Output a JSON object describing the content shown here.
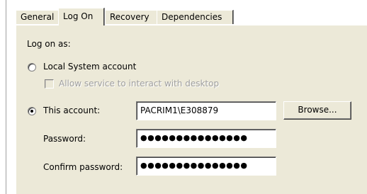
{
  "tabs": [
    {
      "label": "General"
    },
    {
      "label": "Log On"
    },
    {
      "label": "Recovery"
    },
    {
      "label": "Dependencies"
    }
  ],
  "active_tab": "Log On",
  "logon": {
    "section_label": "Log on as:",
    "local_system_label": "Local System account",
    "interact_desktop_label": "Allow service to interact with desktop",
    "this_account_label": "This account:",
    "account_value": "PACRIM1\\E308879",
    "password_label": "Password:",
    "password_value": "●●●●●●●●●●●●●●●",
    "confirm_label": "Confirm password:",
    "confirm_value": "●●●●●●●●●●●●●●●",
    "browse_label": "Browse...",
    "selected_option": "This account",
    "interact_desktop_checked": false,
    "interact_desktop_enabled": false
  },
  "colors": {
    "dialog_face": "#ece9d8",
    "disabled_text": "#a0a0a0"
  }
}
